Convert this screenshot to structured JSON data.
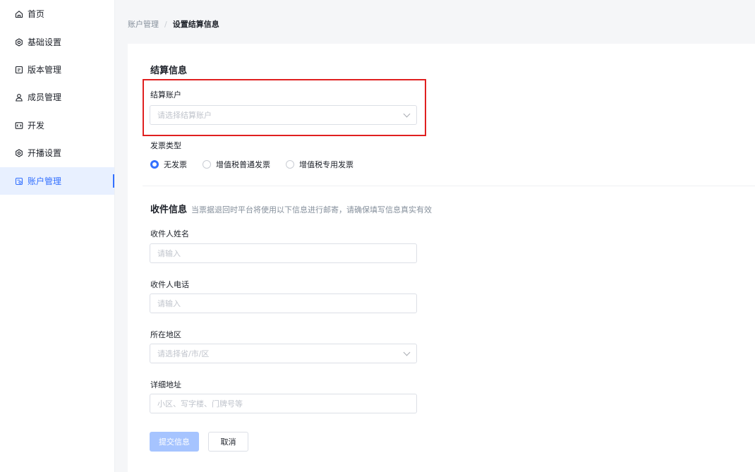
{
  "sidebar": {
    "items": [
      {
        "label": "首页",
        "icon": "home-icon"
      },
      {
        "label": "基础设置",
        "icon": "settings-icon"
      },
      {
        "label": "版本管理",
        "icon": "version-icon"
      },
      {
        "label": "成员管理",
        "icon": "user-icon"
      },
      {
        "label": "开发",
        "icon": "code-icon"
      },
      {
        "label": "开播设置",
        "icon": "broadcast-icon"
      },
      {
        "label": "账户管理",
        "icon": "account-icon",
        "active": true
      }
    ]
  },
  "breadcrumb": {
    "parent": "账户管理",
    "separator": "/",
    "current": "设置结算信息"
  },
  "settlement": {
    "title": "结算信息",
    "account_label": "结算账户",
    "account_placeholder": "请选择结算账户",
    "invoice_label": "发票类型",
    "invoice_options": [
      "无发票",
      "增值税普通发票",
      "增值税专用发票"
    ],
    "invoice_selected": "无发票"
  },
  "receiver": {
    "title": "收件信息",
    "hint": "当票据退回时平台将使用以下信息进行邮寄，请确保填写信息真实有效",
    "name_label": "收件人姓名",
    "name_placeholder": "请输入",
    "phone_label": "收件人电话",
    "phone_placeholder": "请输入",
    "region_label": "所在地区",
    "region_placeholder": "请选择省/市/区",
    "address_label": "详细地址",
    "address_placeholder": "小区、写字楼、门牌号等"
  },
  "actions": {
    "submit": "提交信息",
    "cancel": "取消"
  },
  "colors": {
    "primary": "#3370ff",
    "primary_disabled": "#a6c4ff",
    "highlight": "#e02020"
  }
}
